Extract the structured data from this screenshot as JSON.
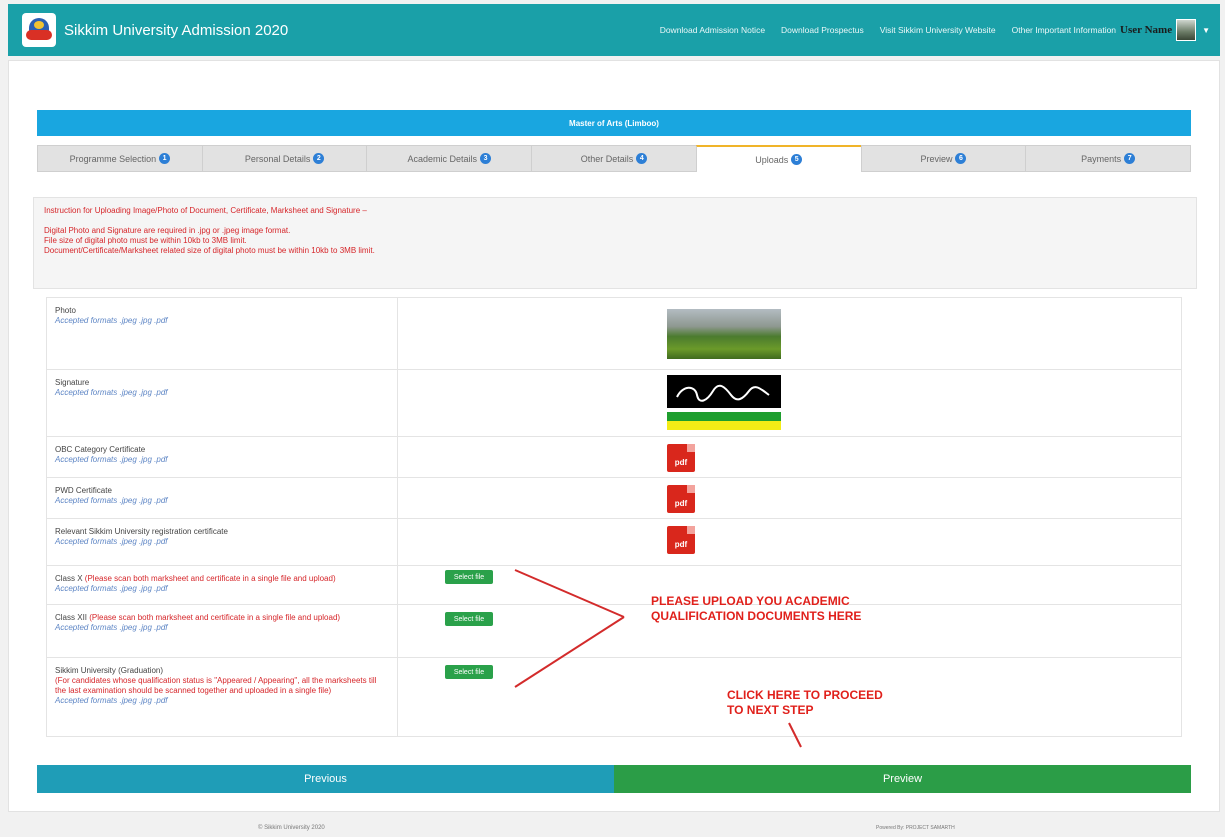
{
  "header": {
    "title": "Sikkim University Admission 2020",
    "nav": [
      "Download Admission Notice",
      "Download Prospectus",
      "Visit Sikkim University Website",
      "Other Important Information"
    ],
    "user_name": "User Name"
  },
  "programme": "Master of Arts (Limboo)",
  "tabs": [
    {
      "label": "Programme Selection",
      "num": "1"
    },
    {
      "label": "Personal Details",
      "num": "2"
    },
    {
      "label": "Academic Details",
      "num": "3"
    },
    {
      "label": "Other Details",
      "num": "4"
    },
    {
      "label": "Uploads",
      "num": "5"
    },
    {
      "label": "Preview",
      "num": "6"
    },
    {
      "label": "Payments",
      "num": "7"
    }
  ],
  "instructions": {
    "heading": "Instruction for Uploading Image/Photo of Document, Certificate, Marksheet and Signature –",
    "line1": "Digital Photo and Signature are required in .jpg or .jpeg image format.",
    "line2": "File size of digital photo must be within 10kb to 3MB limit.",
    "line3": "Document/Certificate/Marksheet related size of digital photo must be within 10kb to 3MB limit."
  },
  "formats": "Accepted formats .jpeg .jpg .pdf",
  "pdf_label": "pdf",
  "select_label": "Select file",
  "rows": {
    "photo": "Photo",
    "signature": "Signature",
    "obc": "OBC Category Certificate",
    "pwd": "PWD Certificate",
    "reg": "Relevant Sikkim University registration certificate",
    "classx": "Class X",
    "classx_note": "(Please scan both marksheet and certificate in a single file and upload)",
    "classxii": "Class XII",
    "classxii_note": "(Please scan both marksheet and certificate in a single file and upload)",
    "grad": "Sikkim University (Graduation)",
    "grad_note": "(For candidates whose qualification status is \"Appeared / Appearing\", all the marksheets till the last examination should be scanned together and uploaded in a single file)"
  },
  "annotations": {
    "upload_line1": "PLEASE UPLOAD YOU ACADEMIC",
    "upload_line2": "QUALIFICATION DOCUMENTS HERE",
    "proceed_line1": "CLICK HERE TO PROCEED",
    "proceed_line2": "TO NEXT STEP"
  },
  "buttons": {
    "previous": "Previous",
    "preview": "Preview"
  },
  "footer": {
    "left": "© Sikkim University 2020",
    "right": "Powered By: PROJECT SAMARTH"
  }
}
